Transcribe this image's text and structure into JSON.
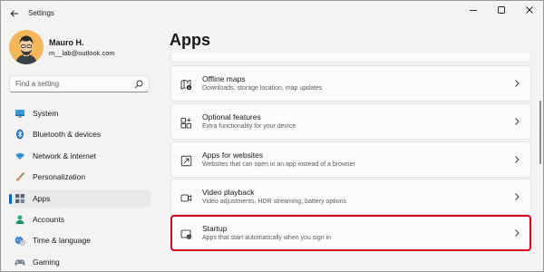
{
  "window": {
    "title": "Settings"
  },
  "user": {
    "name": "Mauro H.",
    "email": "m__lab@outlook.com"
  },
  "search": {
    "placeholder": "Find a setting"
  },
  "sidebar": {
    "items": [
      {
        "label": "System",
        "icon": "monitor-icon",
        "active": false
      },
      {
        "label": "Bluetooth & devices",
        "icon": "bluetooth-icon",
        "active": false
      },
      {
        "label": "Network & internet",
        "icon": "wifi-icon",
        "active": false
      },
      {
        "label": "Personalization",
        "icon": "brush-icon",
        "active": false
      },
      {
        "label": "Apps",
        "icon": "apps-icon",
        "active": true
      },
      {
        "label": "Accounts",
        "icon": "person-icon",
        "active": false
      },
      {
        "label": "Time & language",
        "icon": "globe-clock-icon",
        "active": false
      },
      {
        "label": "Gaming",
        "icon": "gamepad-icon",
        "active": false
      }
    ]
  },
  "main": {
    "title": "Apps",
    "cards": [
      {
        "title": "Offline maps",
        "description": "Downloads, storage location, map updates",
        "icon": "map-download-icon"
      },
      {
        "title": "Optional features",
        "description": "Extra functionality for your device",
        "icon": "optional-features-icon"
      },
      {
        "title": "Apps for websites",
        "description": "Websites that can open in an app instead of a browser",
        "icon": "open-in-app-icon"
      },
      {
        "title": "Video playback",
        "description": "Video adjustments, HDR streaming, battery options",
        "icon": "video-icon"
      },
      {
        "title": "Startup",
        "description": "Apps that start automatically when you sign in",
        "icon": "startup-icon",
        "highlighted": true
      }
    ]
  },
  "colors": {
    "accent": "#005fb8",
    "highlight_border": "#d0021b",
    "background": "#f3f3f3",
    "card": "#fbfbfb"
  }
}
